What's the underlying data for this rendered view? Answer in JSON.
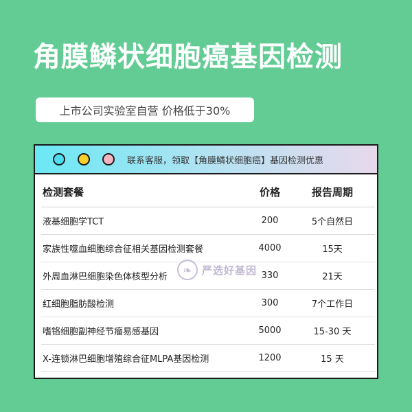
{
  "header": {
    "title": "角膜鳞状细胞癌基因检测",
    "subtitle": "上市公司实验室自营 价格低于30%"
  },
  "window": {
    "bar_text": "联系客服，领取【角膜鳞状细胞癌】基因检测优惠",
    "colors": {
      "blue": "#4fdcf0",
      "yellow": "#f7d02c",
      "pink": "#f6b3c0"
    }
  },
  "table": {
    "columns": {
      "name": "检测套餐",
      "price": "价格",
      "period": "报告周期"
    },
    "rows": [
      {
        "name": "液基细胞学TCT",
        "price": "200",
        "period": "5个自然日"
      },
      {
        "name": "家族性噬血细胞综合征相关基因检测套餐",
        "price": "4000",
        "period": "15天"
      },
      {
        "name": "外周血淋巴细胞染色体核型分析",
        "price": "330",
        "period": "21天"
      },
      {
        "name": "红细胞脂肪酸检测",
        "price": "300",
        "period": "7个工作日"
      },
      {
        "name": "嗜铬细胞副神经节瘤易感基因",
        "price": "5000",
        "period": "15-30 天"
      },
      {
        "name": "X-连锁淋巴细胞增殖综合征MLPA基因检测",
        "price": "1200",
        "period": "15 天"
      }
    ]
  },
  "watermark": {
    "text": "严选好基因",
    "icon": "dna-logo-icon"
  },
  "colors": {
    "background": "#62cc94",
    "title": "#ffffff"
  }
}
